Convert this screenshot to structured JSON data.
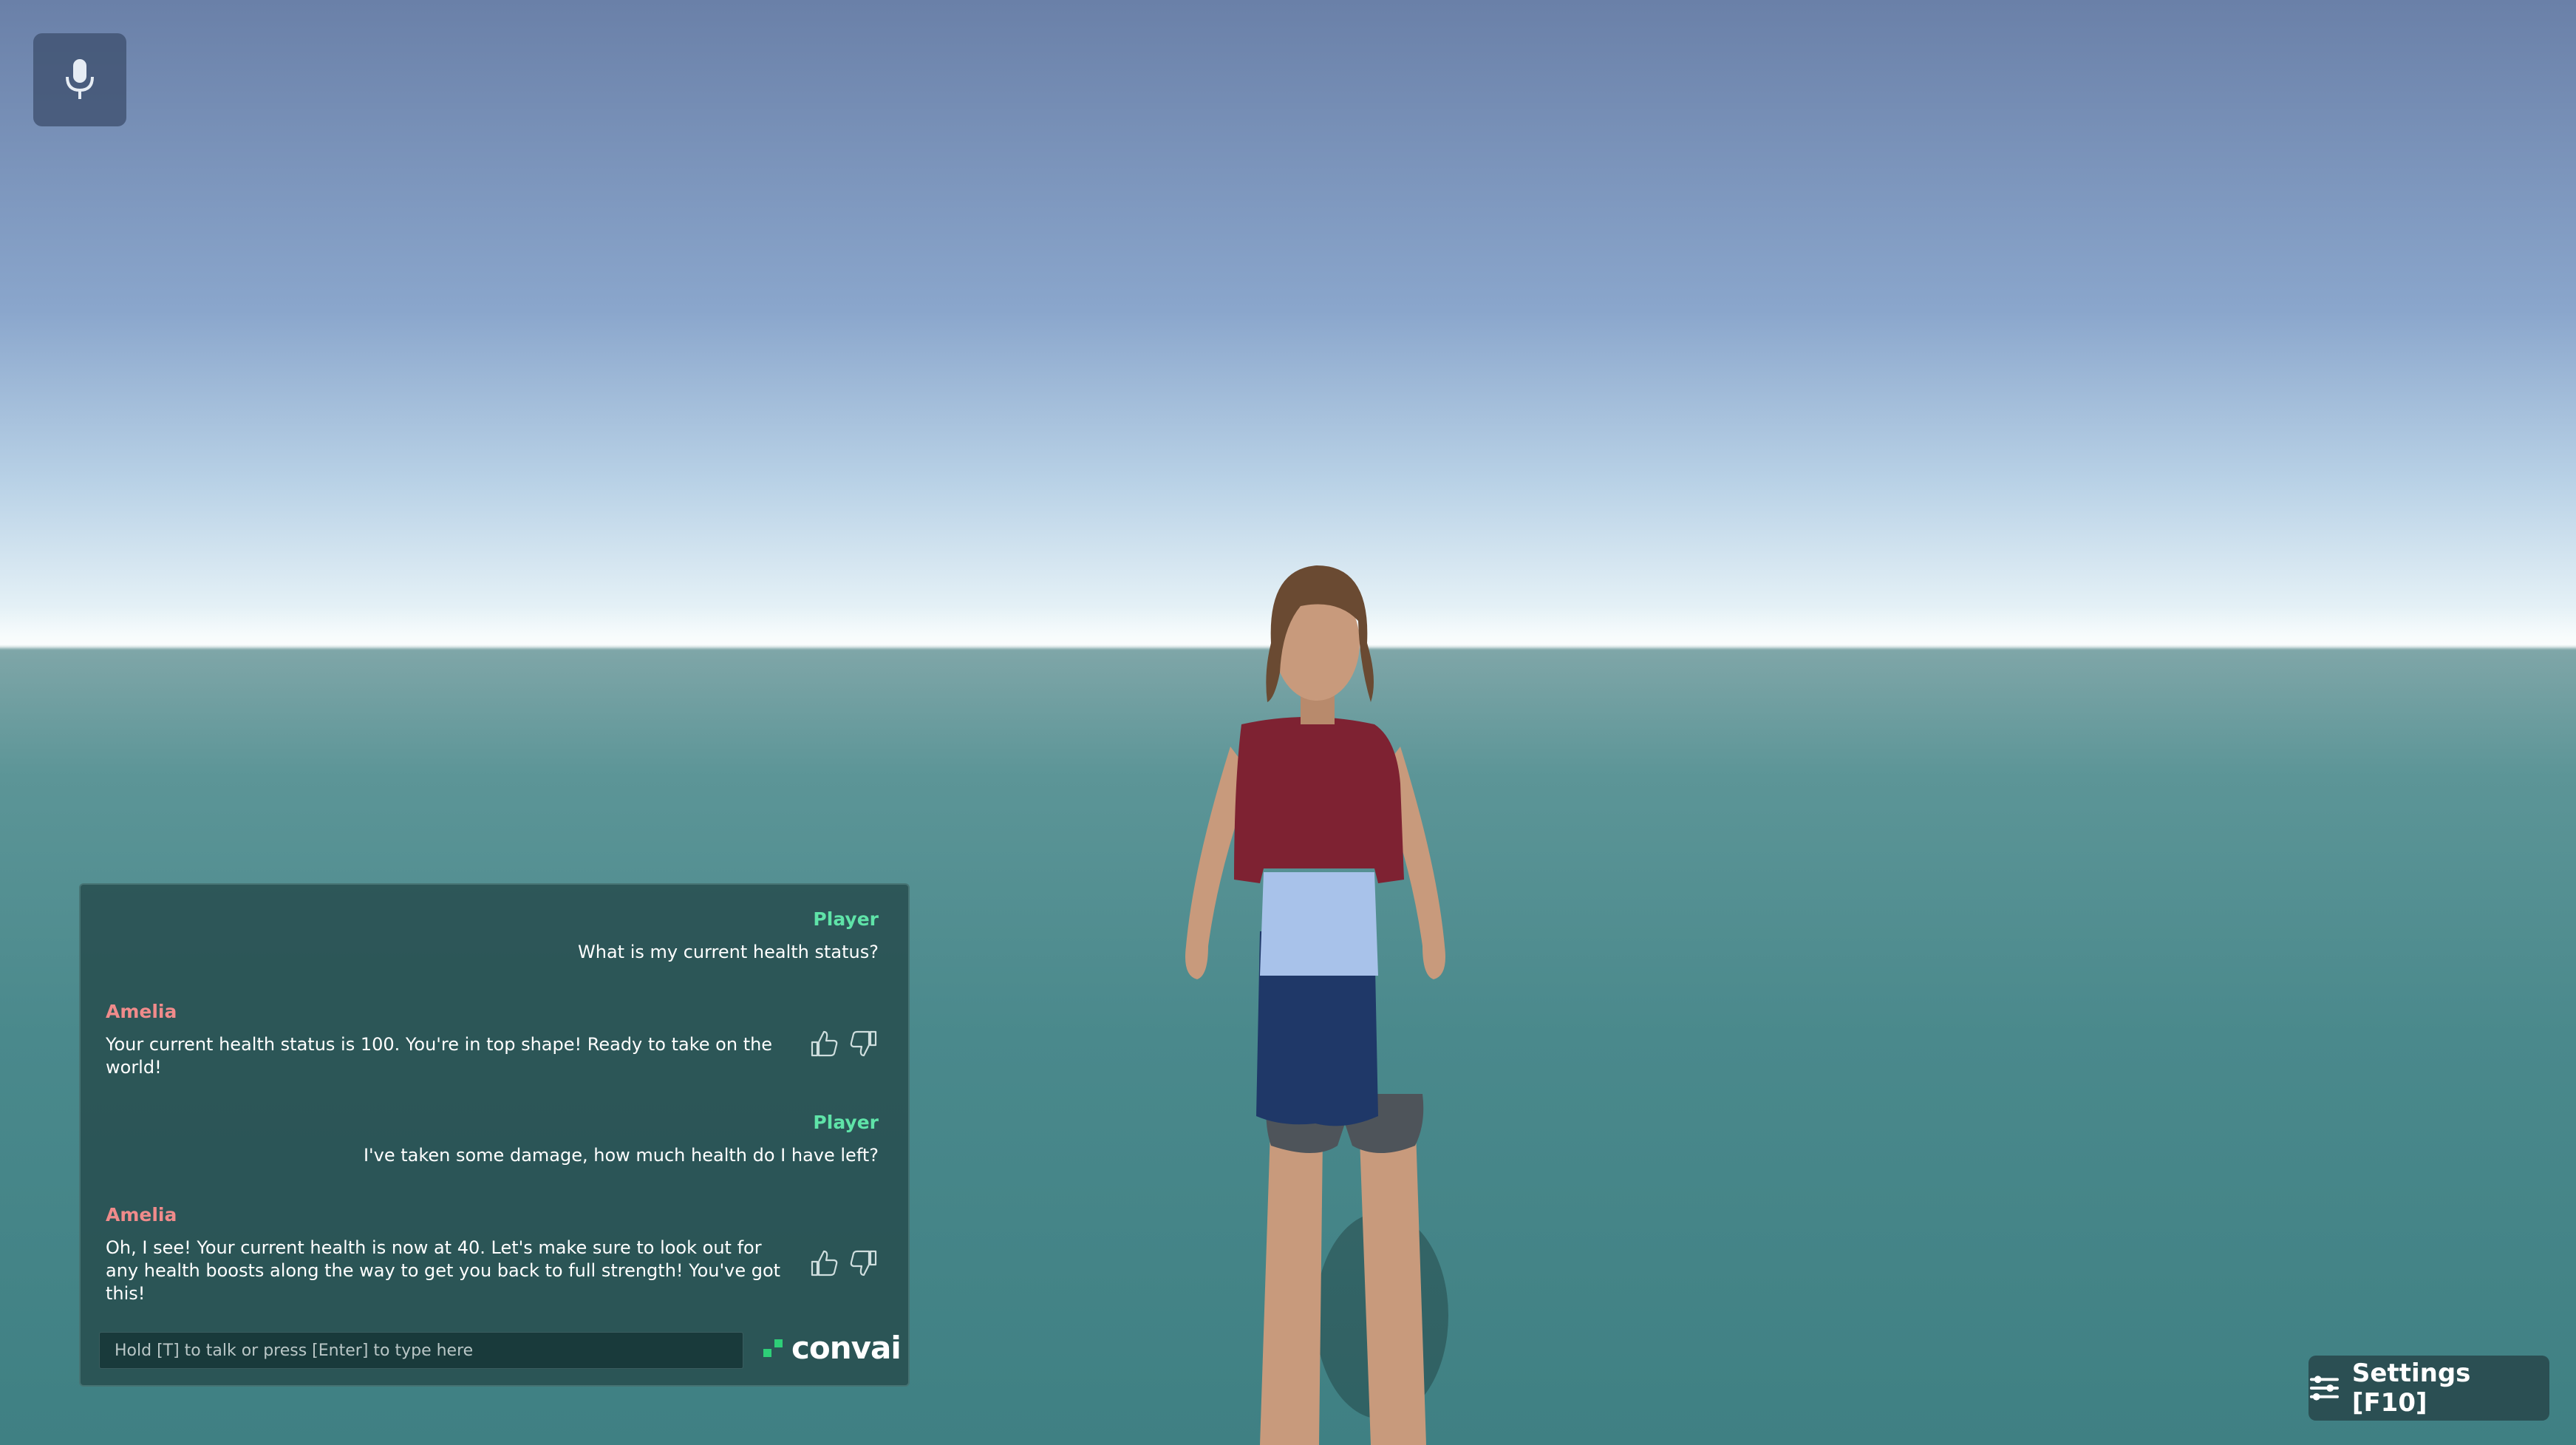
{
  "hud": {
    "mic_icon": "microphone-icon"
  },
  "chat": {
    "messages": [
      {
        "sender": "Player",
        "text": "What is my current health status?"
      },
      {
        "sender": "Amelia",
        "text": "Your current health status is 100. You're in top shape! Ready to take on the world!",
        "feedback": [
          "thumbs-up-icon",
          "thumbs-down-icon"
        ]
      },
      {
        "sender": "Player",
        "text": "I've taken some damage, how much health do I have left?"
      },
      {
        "sender": "Amelia",
        "text": "Oh, I see! Your current health is now at 40. Let's make sure to look out for any health boosts along the way to get you back to full strength! You've got this!",
        "feedback": [
          "thumbs-up-icon",
          "thumbs-down-icon"
        ]
      }
    ],
    "input_placeholder": "Hold [T] to talk or press [Enter] to type here",
    "brand": "convai"
  },
  "settings": {
    "label": "Settings [F10]",
    "icon": "sliders-icon"
  },
  "colors": {
    "player_name": "#5fe3a8",
    "npc_name": "#f08b8b",
    "brand_green": "#2ecf78"
  }
}
